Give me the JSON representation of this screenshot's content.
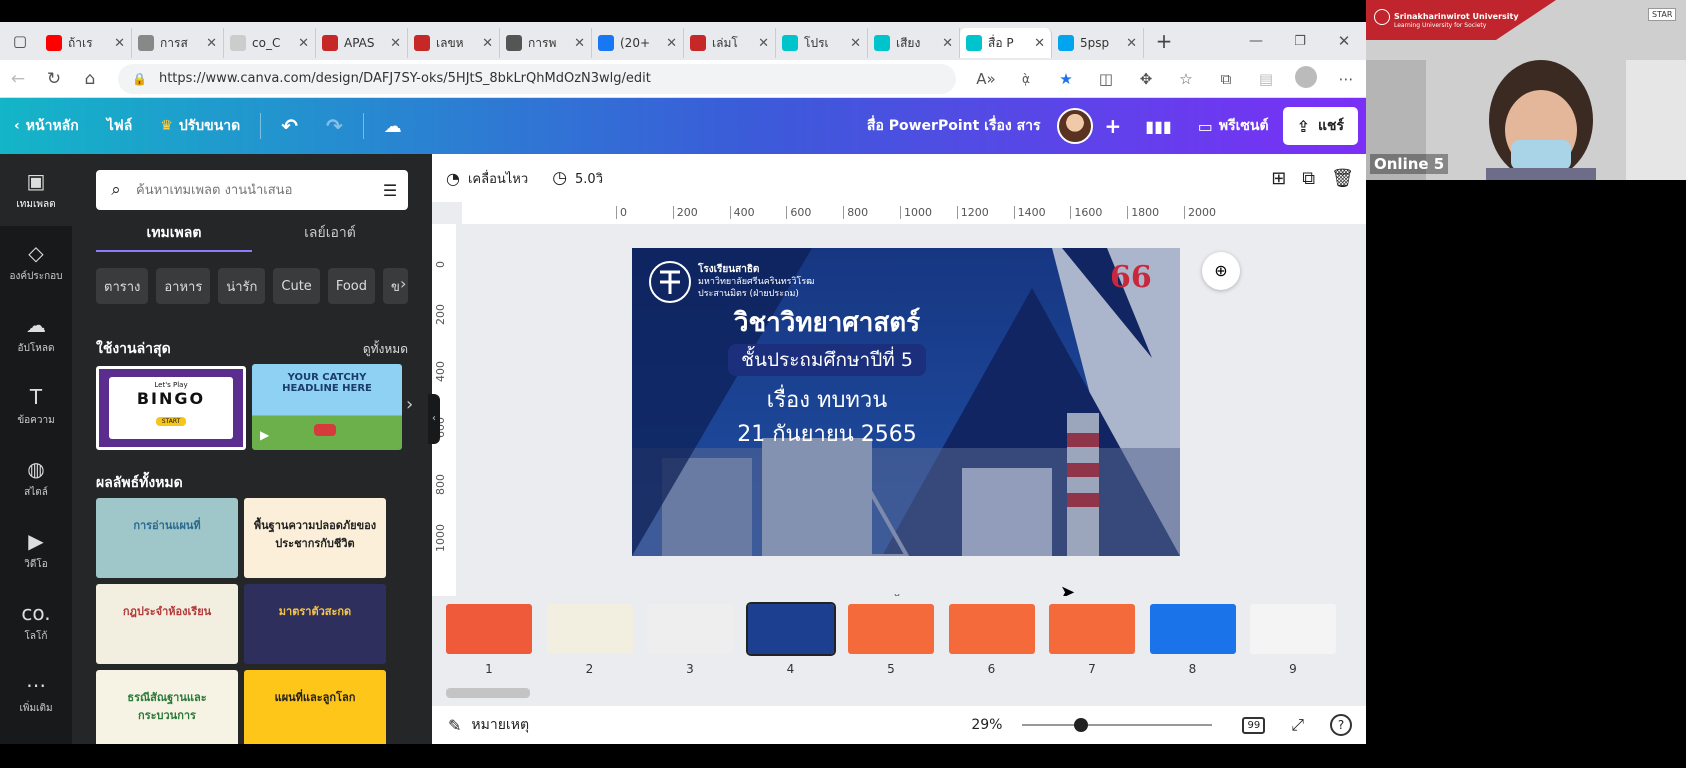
{
  "browser": {
    "tabs": [
      {
        "title": "ถ้าเร",
        "icon": "youtube-icon",
        "color": "#ff0000"
      },
      {
        "title": "การส",
        "icon": "document-icon",
        "color": "#888888"
      },
      {
        "title": "co_C",
        "icon": "triangle-icon",
        "color": "#cccccc"
      },
      {
        "title": "APAS",
        "icon": "pdf-icon",
        "color": "#c62828"
      },
      {
        "title": "เลขห",
        "icon": "pdf-icon",
        "color": "#c62828"
      },
      {
        "title": "การพ",
        "icon": "image-icon",
        "color": "#555555"
      },
      {
        "title": "(20+",
        "icon": "facebook-icon",
        "color": "#1877f2"
      },
      {
        "title": "เล่มโ",
        "icon": "pdf-icon",
        "color": "#c62828"
      },
      {
        "title": "โปรเ",
        "icon": "canva-icon",
        "color": "#00c4cc"
      },
      {
        "title": "เสียง",
        "icon": "canva-icon",
        "color": "#00c4cc"
      },
      {
        "title": "สื่อ P",
        "icon": "canva-icon",
        "color": "#00c4cc",
        "active": true
      },
      {
        "title": "5psp",
        "icon": "bing-icon",
        "color": "#00a4ef"
      }
    ],
    "url": "https://www.canva.com/design/DAFJ7SY-oks/5HJtS_8bkLrQhMdOzN3wlg/edit"
  },
  "header": {
    "home": "หน้าหลัก",
    "file": "ไฟล์",
    "resize": "ปรับขนาด",
    "title": "สื่อ PowerPoint เรื่อง สาร",
    "present": "พรีเซนต์",
    "share": "แชร์"
  },
  "sidebar": {
    "items": [
      {
        "label": "เทมเพลต",
        "icon": "template-icon",
        "glyph": "▣"
      },
      {
        "label": "องค์ประกอบ",
        "icon": "elements-icon",
        "glyph": "◇"
      },
      {
        "label": "อัปโหลด",
        "icon": "upload-icon",
        "glyph": "☁"
      },
      {
        "label": "ข้อความ",
        "icon": "text-icon",
        "glyph": "T"
      },
      {
        "label": "สไตล์",
        "icon": "palette-icon",
        "glyph": "◍"
      },
      {
        "label": "วิดีโอ",
        "icon": "video-icon",
        "glyph": "▶"
      },
      {
        "label": "โลโก้",
        "icon": "logo-icon",
        "glyph": "co."
      },
      {
        "label": "เพิ่มเติม",
        "icon": "more-icon",
        "glyph": "⋯"
      }
    ]
  },
  "panel": {
    "search_placeholder": "ค้นหาเทมเพลต งานนำเสนอ",
    "tab_templates": "เทมเพลต",
    "tab_layouts": "เลย์เอาต์",
    "chips": [
      "ตาราง",
      "อาหาร",
      "น่ารัก",
      "Cute",
      "Food",
      "ข"
    ],
    "recent_heading": "ใช้งานล่าสุด",
    "see_all": "ดูทั้งหมด",
    "recent_bingo_top": "Let's Play",
    "recent_bingo": "BINGO",
    "recent_bingo_btn": "START",
    "recent_headline": "YOUR CATCHY HEADLINE HERE",
    "results_heading": "ผลลัพธ์ทั้งหมด",
    "templates": [
      {
        "text": "การอ่านแผนที่",
        "bg": "#9fc6c9"
      },
      {
        "text": "พื้นฐานความปลอดภัยของประชากรกับชีวิต",
        "bg": "#fbefd9"
      },
      {
        "text": "กฎประจำห้องเรียน",
        "bg": "#f3efe0"
      },
      {
        "text": "มาตราตัวสะกด",
        "bg": "#2f2f5e"
      },
      {
        "text": "ธรณีสัณฐานและกระบวนการ",
        "bg": "#f6f3e4"
      },
      {
        "text": "แผนที่และลูกโลก",
        "bg": "#ffc61a"
      }
    ]
  },
  "editor": {
    "animate": "เคลื่อนไหว",
    "duration": "5.0วิ",
    "ruler_h": [
      "0",
      "200",
      "400",
      "600",
      "800",
      "1000",
      "1200",
      "1400",
      "1600",
      "1800",
      "2000"
    ],
    "ruler_v": [
      "0",
      "200",
      "400",
      "600",
      "800",
      "1000"
    ],
    "slide": {
      "school": "โรงเรียนสาธิต",
      "university": "มหาวิทยาลัยศรีนครินทรวิโรฒ",
      "branch": "ประสานมิตร (ฝ่ายประถม)",
      "subject": "วิชาวิทยาศาสตร์",
      "grade": "ชั้นประถมศึกษาปีที่ 5",
      "topic": "เรื่อง ทบทวน",
      "date": "21 กันยายน 2565",
      "anniversary": "66"
    },
    "pages": [
      "1",
      "2",
      "3",
      "4",
      "5",
      "6",
      "7",
      "8",
      "9"
    ],
    "notes": "หมายเหตุ",
    "zoom": "29%",
    "page_count": "99"
  },
  "video": {
    "label": "Online 5",
    "university_banner": "Srinakharinwirot University",
    "university_tagline": "Learning University for Society",
    "badge": "STAR"
  }
}
